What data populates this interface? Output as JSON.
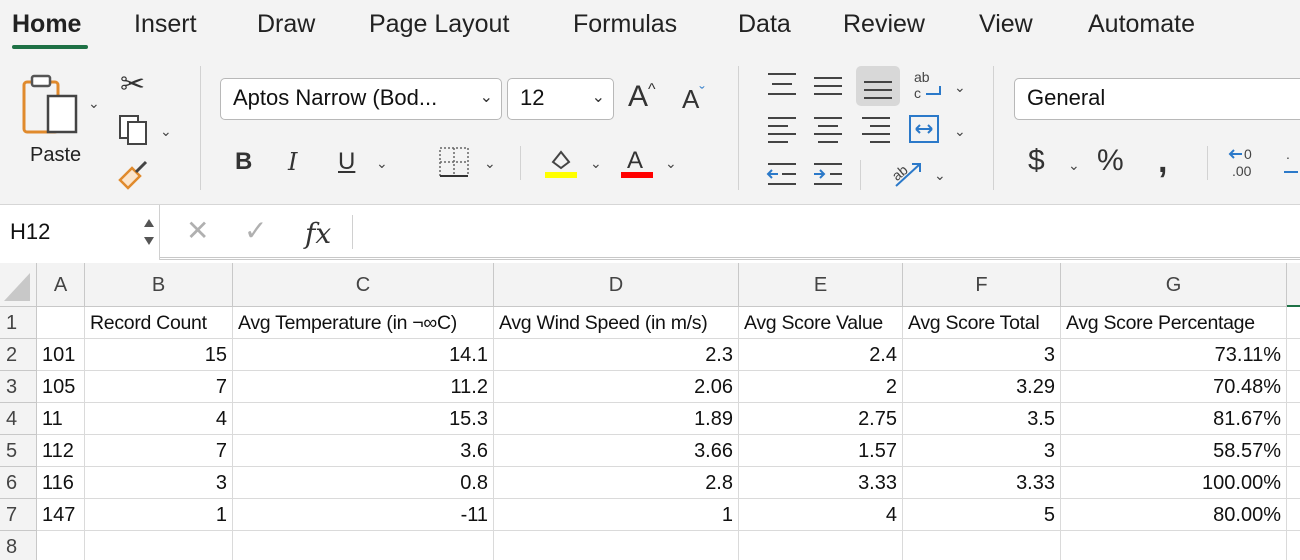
{
  "tabs": [
    "Home",
    "Insert",
    "Draw",
    "Page Layout",
    "Formulas",
    "Data",
    "Review",
    "View",
    "Automate"
  ],
  "clipboard": {
    "paste_label": "Paste"
  },
  "font": {
    "name": "Aptos Narrow (Bod...",
    "size": "12"
  },
  "number_format": "General",
  "formula_bar": {
    "name_box": "H12",
    "formula": ""
  },
  "colors": {
    "accent": "#1e7145",
    "fill_color": "#ffff00",
    "font_color": "#ff0000"
  },
  "sheet": {
    "column_headers": [
      "A",
      "B",
      "C",
      "D",
      "E",
      "F",
      "G"
    ],
    "row_numbers": [
      "1",
      "2",
      "3",
      "4",
      "5",
      "6",
      "7",
      "8"
    ],
    "rows": [
      [
        "",
        "Record Count",
        "Avg Temperature (in ¬∞C)",
        "Avg Wind Speed (in m/s)",
        "Avg Score Value",
        "Avg Score Total",
        "Avg  Score Percentage"
      ],
      [
        "101",
        "15",
        "14.1",
        "2.3",
        "2.4",
        "3",
        "73.11%"
      ],
      [
        "105",
        "7",
        "11.2",
        "2.06",
        "2",
        "3.29",
        "70.48%"
      ],
      [
        "11",
        "4",
        "15.3",
        "1.89",
        "2.75",
        "3.5",
        "81.67%"
      ],
      [
        "112",
        "7",
        "3.6",
        "3.66",
        "1.57",
        "3",
        "58.57%"
      ],
      [
        "116",
        "3",
        "0.8",
        "2.8",
        "3.33",
        "3.33",
        "100.00%"
      ],
      [
        "147",
        "1",
        "-11",
        "1",
        "4",
        "5",
        "80.00%"
      ],
      [
        "",
        "",
        "",
        "",
        "",
        "",
        ""
      ]
    ]
  }
}
